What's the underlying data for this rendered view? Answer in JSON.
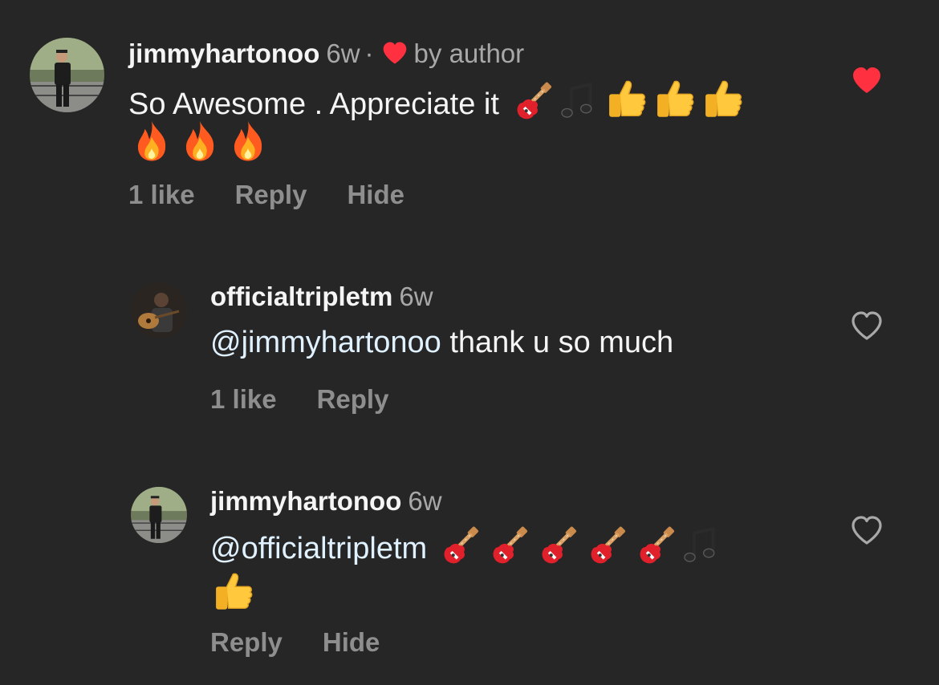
{
  "comments": [
    {
      "username": "jimmyhartonoo",
      "time": "6w",
      "separator": "·",
      "author_badge": "by author",
      "text": "So Awesome . Appreciate it",
      "emojis_line1": [
        "guitar",
        "music-notes",
        "thumbs-up",
        "thumbs-up",
        "thumbs-up"
      ],
      "emojis_line2": [
        "fire",
        "fire",
        "fire"
      ],
      "likes": "1 like",
      "reply": "Reply",
      "hide": "Hide",
      "liked": true,
      "avatar": "person-avatar"
    },
    {
      "username": "officialtripletm",
      "time": "6w",
      "mention": "@jimmyhartonoo",
      "text": " thank u so much",
      "likes": "1 like",
      "reply": "Reply",
      "liked": false,
      "avatar": "guitarist-avatar"
    },
    {
      "username": "jimmyhartonoo",
      "time": "6w",
      "mention": "@officialtripletm",
      "emojis_line1": [
        "guitar",
        "guitar",
        "guitar",
        "guitar",
        "guitar",
        "music-notes"
      ],
      "emojis_line2": [
        "thumbs-up"
      ],
      "reply": "Reply",
      "hide": "Hide",
      "liked": false,
      "avatar": "person-avatar"
    }
  ],
  "colors": {
    "background": "#262626",
    "heart_red": "#ff3040",
    "muted_text": "#8e8e8e",
    "mention": "#e0f1ff"
  }
}
